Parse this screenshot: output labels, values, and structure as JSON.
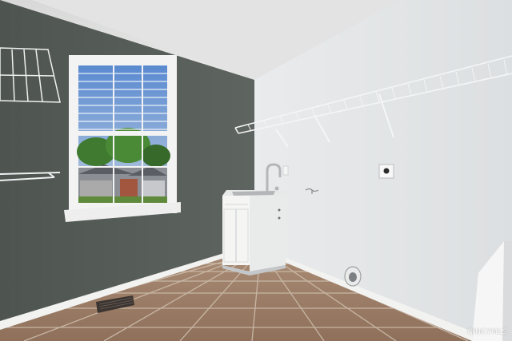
{
  "photo": {
    "subject": "laundry-room",
    "watermark_text": "CINCYMLS"
  },
  "colors": {
    "left_wall": "#555b57",
    "right_wall": "#e6e8e9",
    "ceiling": "#dfe0df",
    "floor_tile": "#9c7d67",
    "grout": "#c9b9a9",
    "trim": "#f1f1f0",
    "sky": "#6d98cf",
    "trees": "#3f7a30",
    "cabinet": "#f4f4f3"
  }
}
